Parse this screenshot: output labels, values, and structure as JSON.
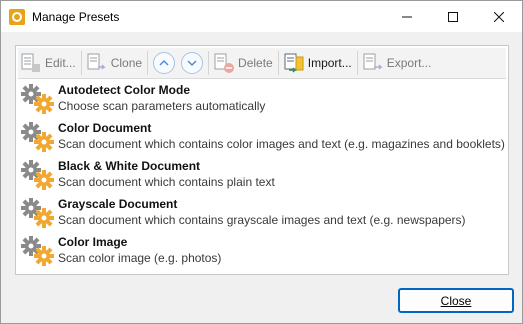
{
  "window": {
    "title": "Manage Presets"
  },
  "toolbar": {
    "edit_label": "Edit...",
    "clone_label": "Clone",
    "delete_label": "Delete",
    "import_label": "Import...",
    "export_label": "Export..."
  },
  "presets": [
    {
      "name": "Autodetect Color Mode",
      "description": "Choose scan parameters automatically"
    },
    {
      "name": "Color Document",
      "description": "Scan document which contains color images and text (e.g. magazines and booklets)"
    },
    {
      "name": "Black & White Document",
      "description": "Scan document which contains plain text"
    },
    {
      "name": "Grayscale Document",
      "description": "Scan document which contains grayscale images and text (e.g. newspapers)"
    },
    {
      "name": "Color Image",
      "description": "Scan color image (e.g. photos)"
    }
  ],
  "footer": {
    "close_label": "Close"
  },
  "colors": {
    "accent": "#0067c0",
    "gear_gray": "#8a8a8a",
    "gear_orange": "#f0a830"
  }
}
